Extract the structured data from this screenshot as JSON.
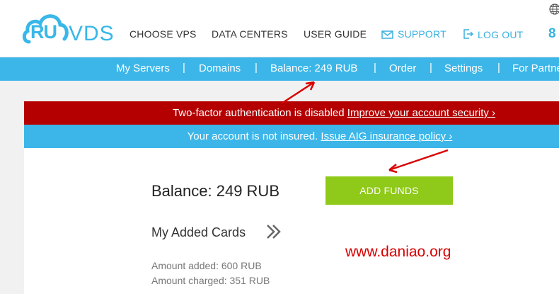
{
  "logo": {
    "ru": "RU",
    "vds": "VDS"
  },
  "topnav": {
    "items": [
      {
        "label": "CHOOSE VPS"
      },
      {
        "label": "DATA CENTERS"
      },
      {
        "label": "USER GUIDE"
      },
      {
        "label": "SUPPORT",
        "icon": "envelope-icon"
      },
      {
        "label": "LOG OUT",
        "icon": "logout-icon"
      }
    ],
    "phone_partial": "8"
  },
  "subnav": {
    "items": [
      {
        "label": "My Servers"
      },
      {
        "label": "Domains"
      },
      {
        "label": "Balance: 249 RUB"
      },
      {
        "label": "Order"
      },
      {
        "label": "Settings"
      },
      {
        "label": "For Partne"
      }
    ],
    "separator": "|"
  },
  "alerts": {
    "twofa": {
      "text": "Two-factor authentication is disabled ",
      "link": "Improve your account security ›"
    },
    "insurance": {
      "text": "Your account is not insured. ",
      "link": "Issue AIG insurance policy ›"
    }
  },
  "main": {
    "balance": "Balance: 249 RUB",
    "add_funds": "ADD FUNDS",
    "cards_title": "My Added Cards",
    "amount_added": "Amount added: 600 RUB",
    "amount_charged": "Amount charged: 351 RUB"
  },
  "watermark": "www.daniao.org",
  "colors": {
    "brand_blue": "#3cb6e8",
    "alert_red": "#b40000",
    "button_green": "#8fc919",
    "annotation_red": "#d80000"
  }
}
